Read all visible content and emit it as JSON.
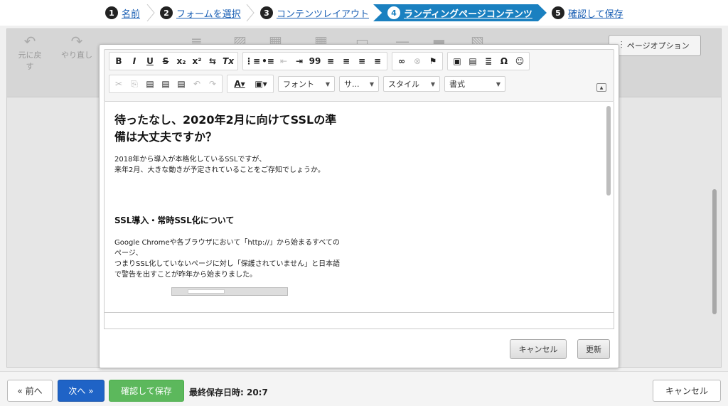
{
  "wizard": {
    "steps": [
      {
        "num": "1",
        "label": "名前"
      },
      {
        "num": "2",
        "label": "フォームを選択"
      },
      {
        "num": "3",
        "label": "コンテンツレイアウト"
      },
      {
        "num": "4",
        "label": "ランディングページコンテンツ"
      },
      {
        "num": "5",
        "label": "確認して保存"
      }
    ],
    "active_step": 4
  },
  "toolbar": {
    "undo_label": "元に戻す",
    "redo_label": "やり直し",
    "page_options_label": "ページオプション"
  },
  "editor": {
    "toolbar_row1": [
      "B",
      "I",
      "U",
      "S",
      "x₂",
      "x²",
      "⇆",
      "Tx",
      "⋮≡",
      "•≡",
      "⇤",
      "⇥",
      "99",
      "≡",
      "≡",
      "≡",
      "≡",
      "∞",
      "⊗",
      "⚑",
      "▣",
      "▤",
      "≣",
      "Ω",
      "☺"
    ],
    "font_label": "フォント",
    "size_label": "サ...",
    "style_label": "スタイル",
    "format_label": "書式",
    "heading1": "待ったなし、2020年2月に向けてSSLの準備は大丈夫ですか？",
    "para1_line1": "2018年から導入が本格化しているSSLですが、",
    "para1_line2": "来年2月、大きな動きが予定されていることをご存知でしょうか。",
    "heading2": "SSL導入・常時SSL化について",
    "para2_line1": "Google Chromeや各ブラウザにおいて「http://」から始まるすべてのページ、",
    "para2_line2": "つまりSSL化していないページに対し「保護されていません」と日本語で警告を出すことが昨年から始まりました。"
  },
  "dialog": {
    "cancel_label": "キャンセル",
    "update_label": "更新"
  },
  "footer": {
    "prev_label": "« 前へ",
    "next_label": "次へ »",
    "save_label": "確認して保存",
    "last_saved": "最終保存日時: 20:7",
    "cancel_label": "キャンセル"
  }
}
